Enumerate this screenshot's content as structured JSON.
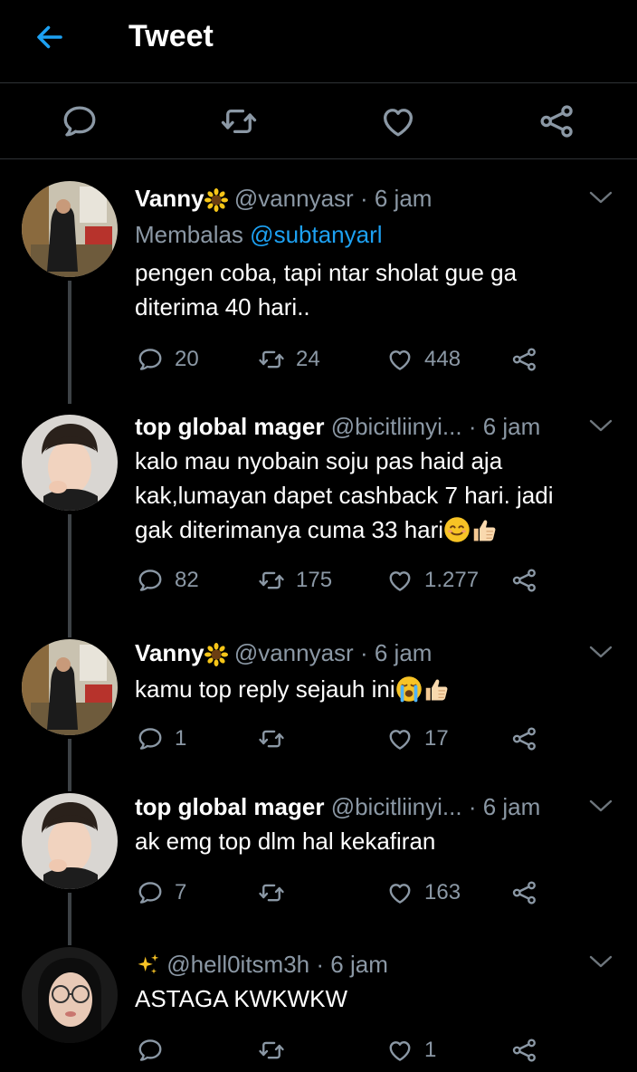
{
  "header": {
    "title": "Tweet"
  },
  "tweets": [
    {
      "name": "Vanny",
      "name_emoji": "sunflower-icon",
      "handle": "@vannyasr",
      "dot": "·",
      "time": "6 jam",
      "reply_prefix": "Membalas",
      "reply_to": "@subtanyarl",
      "lines": [
        "pengen coba, tapi ntar sholat gue ga",
        "diterima 40 hari.."
      ],
      "replies": "20",
      "retweets": "24",
      "likes": "448"
    },
    {
      "name": "top global mager",
      "handle": "@bicitliinyi...",
      "dot": "·",
      "time": "6 jam",
      "lines": [
        "kalo mau nyobain soju pas haid aja",
        "kak,lumayan dapet cashback 7 hari. jadi",
        "gak diterimanya cuma 33 hari"
      ],
      "line_emojis": [
        "smiling-face-icon",
        "thumbs-up-icon"
      ],
      "replies": "82",
      "retweets": "175",
      "likes": "1.277"
    },
    {
      "name": "Vanny",
      "name_emoji": "sunflower-icon",
      "handle": "@vannyasr",
      "dot": "·",
      "time": "6 jam",
      "lines": [
        "kamu top reply sejauh ini"
      ],
      "line_emojis": [
        "crying-face-icon",
        "thumbs-up-icon"
      ],
      "replies": "1",
      "retweets": "",
      "likes": "17"
    },
    {
      "name": "top global mager",
      "handle": "@bicitliinyi...",
      "dot": "·",
      "time": "6 jam",
      "lines": [
        "ak emg top dlm hal kekafiran"
      ],
      "replies": "7",
      "retweets": "",
      "likes": "163"
    },
    {
      "name_emoji": "sparkles-icon",
      "handle": "@hell0itsm3h",
      "dot": "·",
      "time": "6 jam",
      "lines": [
        "ASTAGA KWKWKW"
      ],
      "replies": "",
      "retweets": "",
      "likes": "1"
    }
  ],
  "colors": {
    "background": "#000000",
    "muted": "#8b98a5",
    "accent": "#1da1f2",
    "divider": "#2f3336"
  }
}
